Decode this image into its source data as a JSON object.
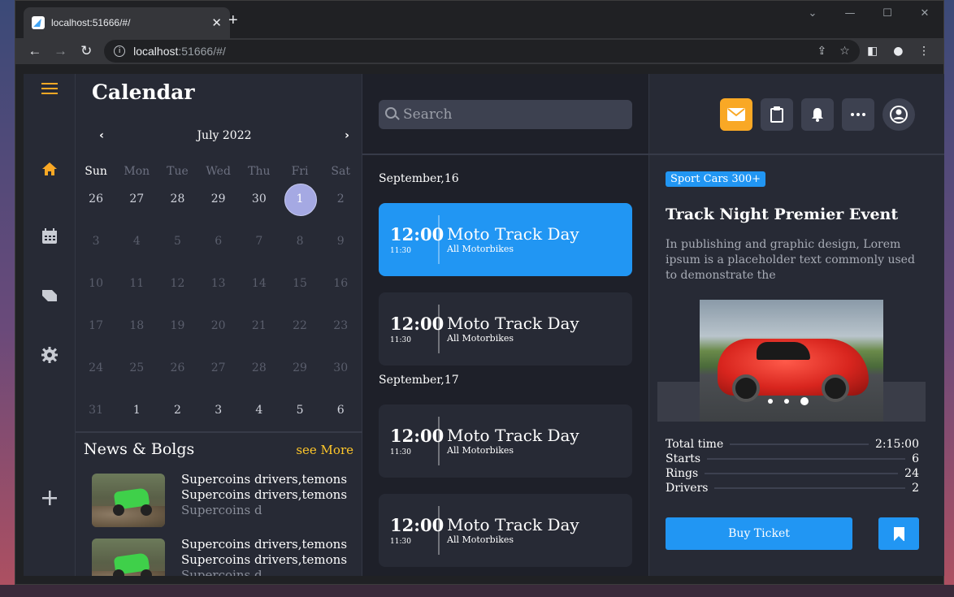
{
  "browser": {
    "tab_title": "localhost:51666/#/",
    "new_tab": "+",
    "url_host": "localhost",
    "url_path": ":51666/#/"
  },
  "calendar": {
    "title": "Calendar",
    "month": "July 2022",
    "days_of_week": [
      "Sun",
      "Mon",
      "Tue",
      "Wed",
      "Thu",
      "Fri",
      "Sat"
    ],
    "weeks": [
      [
        "26",
        "27",
        "28",
        "29",
        "30",
        "1",
        "2"
      ],
      [
        "3",
        "4",
        "5",
        "6",
        "7",
        "8",
        "9"
      ],
      [
        "10",
        "11",
        "12",
        "13",
        "14",
        "15",
        "16"
      ],
      [
        "17",
        "18",
        "19",
        "20",
        "21",
        "22",
        "23"
      ],
      [
        "24",
        "25",
        "26",
        "27",
        "28",
        "29",
        "30"
      ],
      [
        "31",
        "1",
        "2",
        "3",
        "4",
        "5",
        "6"
      ]
    ],
    "selected_day": "1"
  },
  "news": {
    "title": "News & Bolgs",
    "see_more": "see More",
    "items": [
      {
        "line1": "Supercoins drivers,temons",
        "line2": "Supercoins drivers,temons",
        "line3": "Supercoins d"
      },
      {
        "line1": "Supercoins drivers,temons",
        "line2": "Supercoins drivers,temons",
        "line3": "Supercoins d"
      }
    ]
  },
  "search": {
    "placeholder": "Search"
  },
  "events": {
    "groups": [
      {
        "date": "September,16",
        "items": [
          {
            "time": "12:00",
            "sub": "11:30",
            "title": "Moto Track Day",
            "desc": "All Motorbikes",
            "active": true
          },
          {
            "time": "12:00",
            "sub": "11:30",
            "title": "Moto Track Day",
            "desc": "All Motorbikes",
            "active": false
          }
        ]
      },
      {
        "date": "September,17",
        "items": [
          {
            "time": "12:00",
            "sub": "11:30",
            "title": "Moto Track Day",
            "desc": "All Motorbikes",
            "active": false
          },
          {
            "time": "12:00",
            "sub": "11:30",
            "title": "Moto Track Day",
            "desc": "All Motorbikes",
            "active": false
          }
        ]
      }
    ]
  },
  "detail": {
    "badge": "Sport Cars 300+",
    "title": "Track Night Premier Event",
    "description": "In publishing and graphic design, Lorem ipsum is a placeholder text commonly used to demonstrate the",
    "stats": [
      {
        "label": "Total time",
        "value": "2:15:00"
      },
      {
        "label": "Starts",
        "value": "6"
      },
      {
        "label": "Rings",
        "value": "24"
      },
      {
        "label": "Drivers",
        "value": "2"
      }
    ],
    "buy_label": "Buy Ticket"
  },
  "colors": {
    "accent": "#2196f3",
    "highlight": "#ffc72a",
    "orange": "#f9a825",
    "selected_day": "#a5a9e3"
  },
  "icons": {
    "menu": "hamburger-icon",
    "home": "home-icon",
    "calendar": "calendar-icon",
    "label": "label-icon",
    "settings": "gear-icon",
    "add": "plus-icon",
    "mail": "mail-icon",
    "clipboard": "clipboard-icon",
    "bell": "bell-icon",
    "more": "more-icon",
    "profile": "account-icon"
  }
}
